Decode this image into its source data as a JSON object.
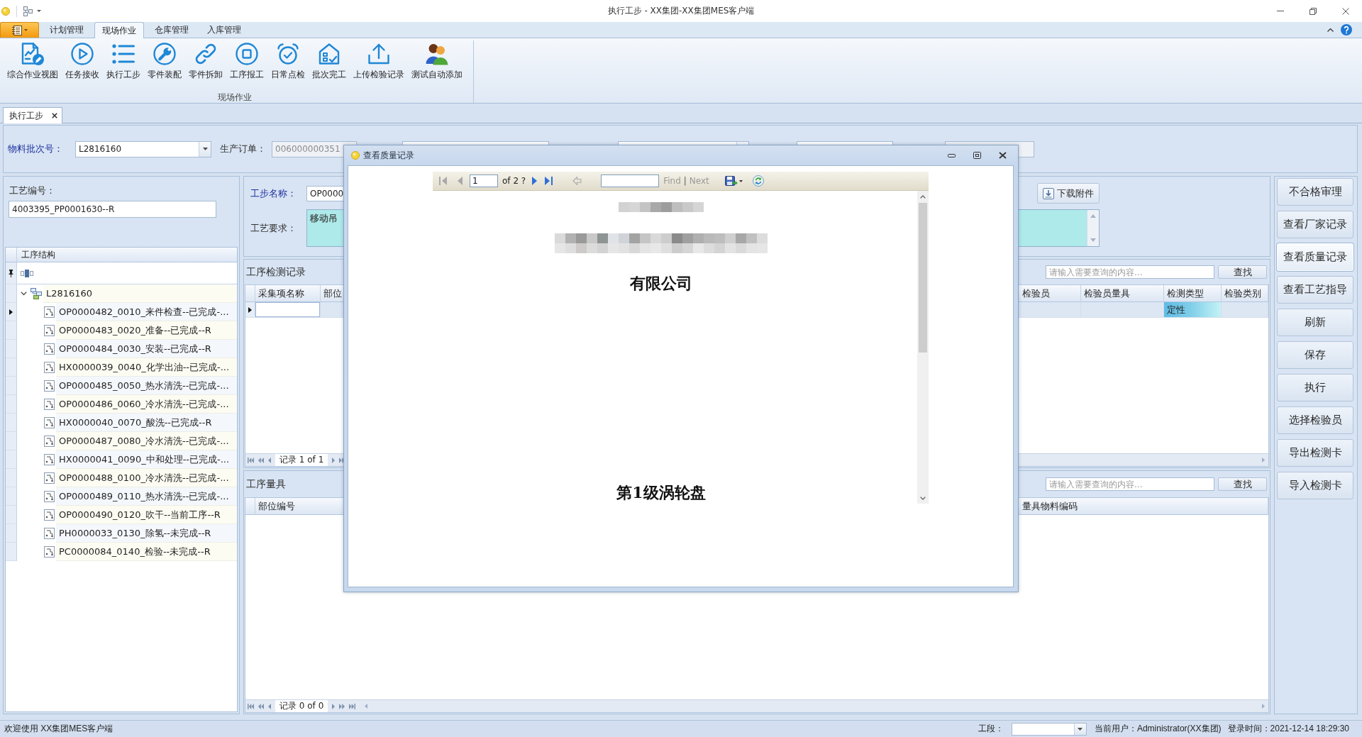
{
  "window": {
    "title": "执行工步 - XX集团-XX集团MES客户端"
  },
  "ribbon": {
    "tabs": [
      {
        "label": "计划管理",
        "selected": false
      },
      {
        "label": "现场作业",
        "selected": true
      },
      {
        "label": "仓库管理",
        "selected": false
      },
      {
        "label": "入库管理",
        "selected": false
      }
    ],
    "groups": [
      {
        "label": "现场作业",
        "buttons": [
          {
            "label": "综合作业视图",
            "kind": "report"
          },
          {
            "label": "任务接收",
            "kind": "play"
          },
          {
            "label": "执行工步",
            "kind": "list"
          },
          {
            "label": "零件装配",
            "kind": "wrench"
          },
          {
            "label": "零件拆卸",
            "kind": "link"
          },
          {
            "label": "工序报工",
            "kind": "stop"
          },
          {
            "label": "日常点检",
            "kind": "alarm"
          },
          {
            "label": "批次完工",
            "kind": "house"
          },
          {
            "label": "上传检验记录",
            "kind": "upload"
          },
          {
            "label": "测试自动添加",
            "kind": "people"
          }
        ]
      }
    ]
  },
  "document_tabs": [
    {
      "label": "执行工步",
      "selected": true
    }
  ],
  "filter_bar": {
    "fields": [
      {
        "kind": "combo",
        "label": "物料批次号：",
        "required": true,
        "value": "L2816160",
        "disabled": false
      },
      {
        "kind": "text",
        "label": "生产订单：",
        "required": false,
        "value": "006000000351",
        "disabled": true
      },
      {
        "kind": "text",
        "disabled": false
      },
      {
        "kind": "combo",
        "disabled": false
      },
      {
        "kind": "text",
        "disabled": false
      },
      {
        "kind": "text",
        "disabled": true
      }
    ]
  },
  "process_panel": {
    "label": "工艺编号：",
    "value": "4003395_PP0001630--R",
    "tree": {
      "column": "工序结构",
      "nodes": [
        {
          "label": "L2816160",
          "expanded": true,
          "selected": false,
          "children": [
            {
              "label": "OP0000482_0010_来件检查--已完成-...",
              "selected": true
            },
            {
              "label": "OP0000483_0020_准备--已完成--R",
              "selected": false
            },
            {
              "label": "OP0000484_0030_安装--已完成--R",
              "selected": false
            },
            {
              "label": "HX0000039_0040_化学出油--已完成-...",
              "selected": false
            },
            {
              "label": "OP0000485_0050_热水清洗--已完成-...",
              "selected": false
            },
            {
              "label": "OP0000486_0060_冷水清洗--已完成-...",
              "selected": false
            },
            {
              "label": "HX0000040_0070_酸洗--已完成--R",
              "selected": false
            },
            {
              "label": "OP0000487_0080_冷水清洗--已完成-...",
              "selected": false
            },
            {
              "label": "HX0000041_0090_中和处理--已完成-...",
              "selected": false
            },
            {
              "label": "OP0000488_0100_冷水清洗--已完成-...",
              "selected": false
            },
            {
              "label": "OP0000489_0110_热水清洗--已完成-...",
              "selected": false
            },
            {
              "label": "OP0000490_0120_吹干--当前工序--R",
              "selected": false
            },
            {
              "label": "PH0000033_0130_除氢--未完成--R",
              "selected": false
            },
            {
              "label": "PC0000084_0140_检验--未完成--R",
              "selected": false
            }
          ]
        }
      ]
    }
  },
  "step_info": {
    "name": {
      "label": "工步名称：",
      "required": true,
      "value": "OP0000"
    },
    "requirement": {
      "label": "工艺要求：",
      "required": false,
      "value": "移动吊"
    },
    "download_button": "下载附件"
  },
  "inspection_records": {
    "title": "工序检测记录",
    "search": {
      "placeholder": "请输入需要查询的内容...",
      "button": "查找"
    },
    "columns": [
      "采集项名称",
      "部位",
      "检验员",
      "检验员量具",
      "检测类型",
      "检验类别"
    ],
    "rows": [
      {
        "selected": true,
        "cells": [
          {
            "focused": true,
            "highlighted": false
          },
          {
            "focused": false,
            "highlighted": false
          },
          {
            "focused": false,
            "highlighted": false
          },
          {
            "focused": false,
            "highlighted": false
          },
          {
            "text": "定性",
            "focused": false,
            "highlighted": true
          },
          {
            "focused": false,
            "highlighted": false
          }
        ]
      }
    ],
    "pager": [
      {
        "kind": "first"
      },
      {
        "kind": "previous_page"
      },
      {
        "kind": "previous"
      },
      {
        "kind": "label",
        "text": "记录 1 of 1"
      },
      {
        "kind": "next"
      },
      {
        "kind": "next_page"
      }
    ]
  },
  "measuring_tools": {
    "title": "工序量具",
    "search": {
      "placeholder": "请输入需要查询的内容...",
      "button": "查找"
    },
    "columns": [
      "部位编号",
      "量具物料编码"
    ],
    "pager": [
      {
        "kind": "first"
      },
      {
        "kind": "previous_page"
      },
      {
        "kind": "previous"
      },
      {
        "kind": "label",
        "text": "记录 0 of 0"
      },
      {
        "kind": "next"
      },
      {
        "kind": "next_page"
      },
      {
        "kind": "last"
      }
    ]
  },
  "actions": [
    {
      "label": "不合格审理",
      "focused": false
    },
    {
      "label": "查看厂家记录",
      "focused": false
    },
    {
      "label": "查看质量记录",
      "focused": true
    },
    {
      "label": "查看工艺指导",
      "focused": false
    },
    {
      "label": "刷新",
      "focused": false
    },
    {
      "label": "保存",
      "focused": false
    },
    {
      "label": "执行",
      "focused": false
    },
    {
      "label": "选择检验员",
      "focused": false
    },
    {
      "label": "导出检测卡",
      "focused": false
    },
    {
      "label": "导入检测卡",
      "focused": false
    }
  ],
  "status_bar": {
    "message": "欢迎使用 XX集团MES客户端",
    "section": {
      "label": "工段："
    },
    "user": "当前用户：Administrator(XX集团)",
    "login_time": "登录时间：2021-12-14 18:29:30"
  },
  "dialog": {
    "title": "查看质量记录",
    "toolbar": [
      {
        "kind": "first",
        "disabled": true
      },
      {
        "kind": "previous",
        "disabled": true
      },
      {
        "kind": "page_input",
        "value": "1",
        "disabled": false
      },
      {
        "kind": "label",
        "text": "of 2 ?",
        "disabled": false
      },
      {
        "kind": "next",
        "disabled": false
      },
      {
        "kind": "last",
        "disabled": false
      },
      {
        "kind": "back",
        "disabled": true
      },
      {
        "kind": "find_input",
        "disabled": false
      },
      {
        "kind": "link",
        "text": "Find",
        "disabled": true
      },
      {
        "kind": "label",
        "text": "|",
        "disabled": false
      },
      {
        "kind": "link",
        "text": "Next",
        "disabled": true
      },
      {
        "kind": "save",
        "disabled": false
      },
      {
        "kind": "refresh",
        "disabled": false
      }
    ],
    "report": [
      {
        "kind": "blurred"
      },
      {
        "kind": "blurred"
      },
      {
        "kind": "heading",
        "text": "有限公司"
      },
      {
        "kind": "heading",
        "text": "第1级涡轮盘"
      }
    ]
  }
}
